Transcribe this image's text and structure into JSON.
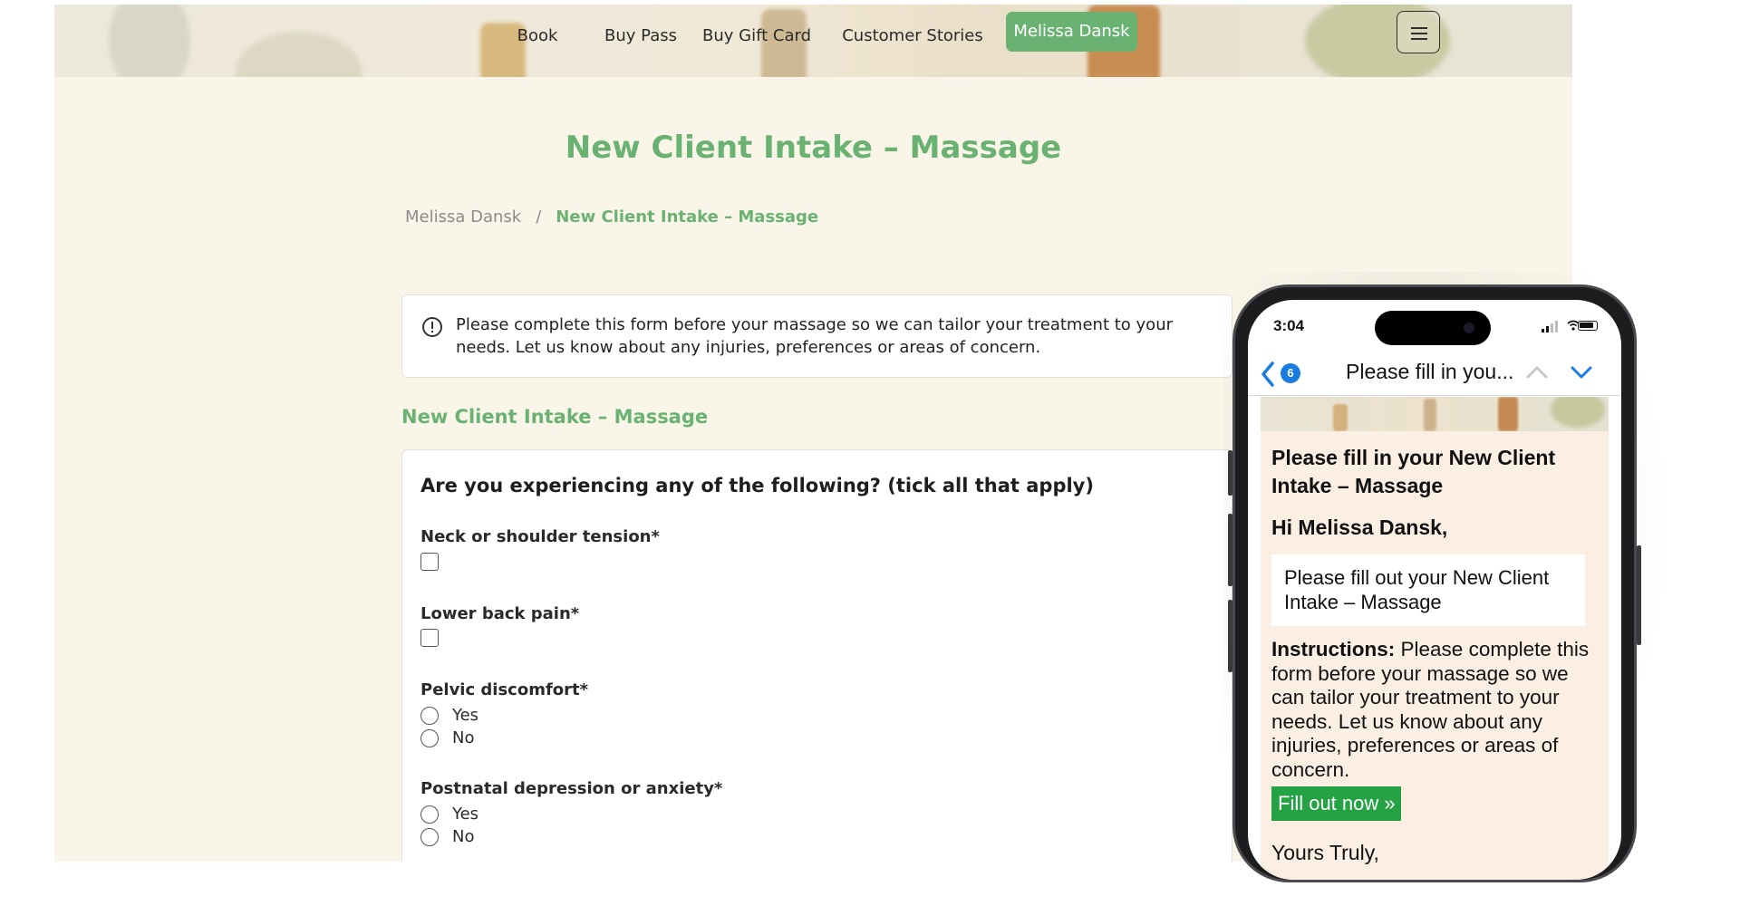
{
  "nav": {
    "items": [
      "Book",
      "Buy Pass",
      "Buy Gift Card",
      "Customer Stories"
    ],
    "active_user": "Melissa Dansk",
    "menu_icon": "hamburger-menu-icon"
  },
  "page_title": "New Client Intake – Massage",
  "breadcrumb": {
    "home": "Melissa Dansk",
    "separator": "/",
    "current": "New Client Intake – Massage"
  },
  "notice": {
    "icon": "info-circle-icon",
    "text": "Please complete this form before your massage so we can tailor your treatment to your needs. Let us know about any injuries, preferences or areas of concern."
  },
  "form": {
    "section_title": "New Client Intake – Massage",
    "question": "Are you experiencing any of the following? (tick all that apply)",
    "fields": {
      "neck": "Neck or shoulder tension*",
      "lower_back": "Lower back pain*",
      "pelvic": "Pelvic discomfort*",
      "postnatal": "Postnatal depression or anxiety*"
    },
    "options": {
      "yes": "Yes",
      "no": "No"
    }
  },
  "phone": {
    "time": "3:04",
    "badge_count": "6",
    "subject": "Please fill in you...",
    "email": {
      "heading": "Please fill in your New Client Intake – Massage",
      "greeting": "Hi Melissa Dansk,",
      "box_text": "Please fill out your New Client Intake – Massage",
      "instructions_label": "Instructions:",
      "instructions_text": " Please complete this form before your massage so we can tailor your treatment to your needs. Let us know about any injuries, preferences or areas of concern.",
      "cta": "Fill out now »",
      "signoff": "Yours Truly,"
    }
  },
  "colors": {
    "accent": "#6ab272",
    "page_bg": "#f9f5e9",
    "email_bg": "#fbeee3",
    "cta": "#25a244",
    "ios_blue": "#1a7be0"
  }
}
